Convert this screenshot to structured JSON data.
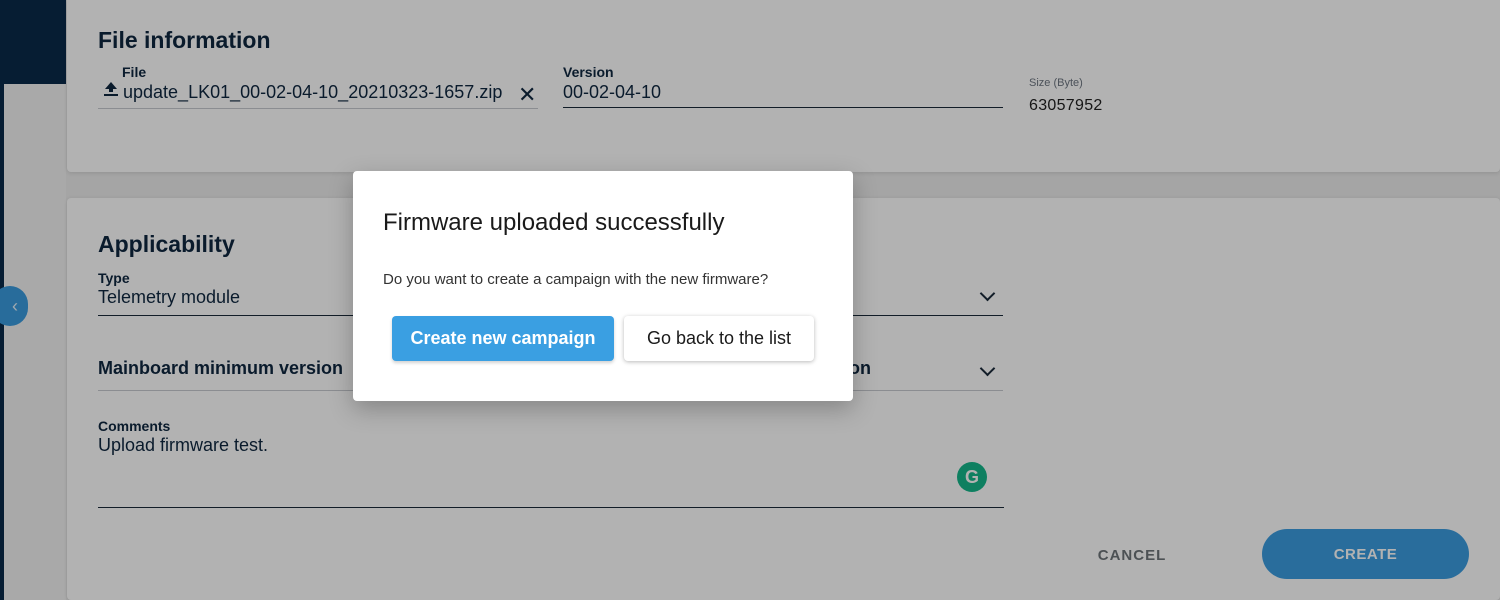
{
  "file_section": {
    "title": "File information",
    "file_label": "File",
    "file_value": "update_LK01_00-02-04-10_20210323-1657.zip",
    "version_label": "Version",
    "version_value": "00-02-04-10",
    "size_label": "Size (Byte)",
    "size_value": "63057952",
    "upload_icon": "upload-icon",
    "clear_icon": "close-icon",
    "clear_glyph": "✕"
  },
  "applicability_section": {
    "title": "Applicability",
    "type_label": "Type",
    "type_value": "Telemetry module",
    "mainboard_label": "Mainboard minimum version",
    "right_select_partial_label": "on",
    "comments_label": "Comments",
    "comments_value": "Upload firmware test.",
    "grammarly_glyph": "G"
  },
  "actions": {
    "cancel_label": "CANCEL",
    "create_label": "CREATE"
  },
  "dialog": {
    "title": "Firmware uploaded successfully",
    "message": "Do you want to create a campaign with the new firmware?",
    "primary_label": "Create new campaign",
    "secondary_label": "Go back to the list"
  },
  "colors": {
    "primary": "#3a9fe2",
    "navy": "#0a2a4a",
    "grammarly": "#15b78a"
  }
}
